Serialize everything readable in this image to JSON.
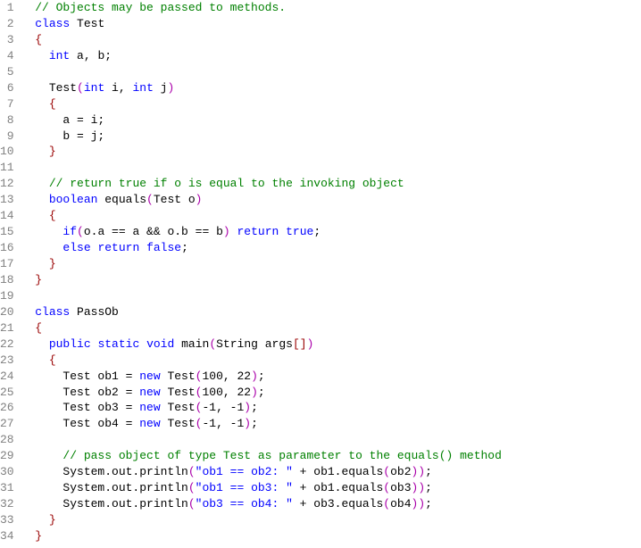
{
  "line_numbers": [
    "1",
    "2",
    "3",
    "4",
    "5",
    "6",
    "7",
    "8",
    "9",
    "10",
    "11",
    "12",
    "13",
    "14",
    "15",
    "16",
    "17",
    "18",
    "19",
    "20",
    "21",
    "22",
    "23",
    "24",
    "25",
    "26",
    "27",
    "28",
    "29",
    "30",
    "31",
    "32",
    "33",
    "34"
  ],
  "tokens": [
    [
      [
        "  ",
        "plain"
      ],
      [
        "// Objects may be passed to methods.",
        "comment"
      ]
    ],
    [
      [
        "  ",
        "plain"
      ],
      [
        "class",
        "keyword"
      ],
      [
        " Test",
        "plain"
      ]
    ],
    [
      [
        "  ",
        "plain"
      ],
      [
        "{",
        "brace"
      ]
    ],
    [
      [
        "    ",
        "plain"
      ],
      [
        "int",
        "keyword"
      ],
      [
        " a, b;",
        "plain"
      ]
    ],
    [
      [
        "",
        "plain"
      ]
    ],
    [
      [
        "    Test",
        "plain"
      ],
      [
        "(",
        "paren"
      ],
      [
        "int",
        "keyword"
      ],
      [
        " i, ",
        "plain"
      ],
      [
        "int",
        "keyword"
      ],
      [
        " j",
        "plain"
      ],
      [
        ")",
        "paren"
      ]
    ],
    [
      [
        "    ",
        "plain"
      ],
      [
        "{",
        "brace"
      ]
    ],
    [
      [
        "      a = i;",
        "plain"
      ]
    ],
    [
      [
        "      b = j;",
        "plain"
      ]
    ],
    [
      [
        "    ",
        "plain"
      ],
      [
        "}",
        "brace"
      ]
    ],
    [
      [
        "",
        "plain"
      ]
    ],
    [
      [
        "    ",
        "plain"
      ],
      [
        "// return true if o is equal to the invoking object",
        "comment"
      ]
    ],
    [
      [
        "    ",
        "plain"
      ],
      [
        "boolean",
        "keyword"
      ],
      [
        " equals",
        "plain"
      ],
      [
        "(",
        "paren"
      ],
      [
        "Test o",
        "plain"
      ],
      [
        ")",
        "paren"
      ]
    ],
    [
      [
        "    ",
        "plain"
      ],
      [
        "{",
        "brace"
      ]
    ],
    [
      [
        "      ",
        "plain"
      ],
      [
        "if",
        "keyword"
      ],
      [
        "(",
        "paren"
      ],
      [
        "o.a == a && o.b == b",
        "plain"
      ],
      [
        ")",
        "paren"
      ],
      [
        " ",
        "plain"
      ],
      [
        "return",
        "keyword"
      ],
      [
        " ",
        "plain"
      ],
      [
        "true",
        "keyword"
      ],
      [
        ";",
        "plain"
      ]
    ],
    [
      [
        "      ",
        "plain"
      ],
      [
        "else",
        "keyword"
      ],
      [
        " ",
        "plain"
      ],
      [
        "return",
        "keyword"
      ],
      [
        " ",
        "plain"
      ],
      [
        "false",
        "keyword"
      ],
      [
        ";",
        "plain"
      ]
    ],
    [
      [
        "    ",
        "plain"
      ],
      [
        "}",
        "brace"
      ]
    ],
    [
      [
        "  ",
        "plain"
      ],
      [
        "}",
        "brace"
      ]
    ],
    [
      [
        "",
        "plain"
      ]
    ],
    [
      [
        "  ",
        "plain"
      ],
      [
        "class",
        "keyword"
      ],
      [
        " PassOb",
        "plain"
      ]
    ],
    [
      [
        "  ",
        "plain"
      ],
      [
        "{",
        "brace"
      ]
    ],
    [
      [
        "    ",
        "plain"
      ],
      [
        "public",
        "keyword"
      ],
      [
        " ",
        "plain"
      ],
      [
        "static",
        "keyword"
      ],
      [
        " ",
        "plain"
      ],
      [
        "void",
        "keyword"
      ],
      [
        " main",
        "plain"
      ],
      [
        "(",
        "paren"
      ],
      [
        "String args",
        "plain"
      ],
      [
        "[]",
        "brace"
      ],
      [
        ")",
        "paren"
      ]
    ],
    [
      [
        "    ",
        "plain"
      ],
      [
        "{",
        "brace"
      ]
    ],
    [
      [
        "      Test ob1 = ",
        "plain"
      ],
      [
        "new",
        "keyword"
      ],
      [
        " Test",
        "plain"
      ],
      [
        "(",
        "paren"
      ],
      [
        "100, 22",
        "plain"
      ],
      [
        ")",
        "paren"
      ],
      [
        ";",
        "plain"
      ]
    ],
    [
      [
        "      Test ob2 = ",
        "plain"
      ],
      [
        "new",
        "keyword"
      ],
      [
        " Test",
        "plain"
      ],
      [
        "(",
        "paren"
      ],
      [
        "100, 22",
        "plain"
      ],
      [
        ")",
        "paren"
      ],
      [
        ";",
        "plain"
      ]
    ],
    [
      [
        "      Test ob3 = ",
        "plain"
      ],
      [
        "new",
        "keyword"
      ],
      [
        " Test",
        "plain"
      ],
      [
        "(",
        "paren"
      ],
      [
        "-1, -1",
        "plain"
      ],
      [
        ")",
        "paren"
      ],
      [
        ";",
        "plain"
      ]
    ],
    [
      [
        "      Test ob4 = ",
        "plain"
      ],
      [
        "new",
        "keyword"
      ],
      [
        " Test",
        "plain"
      ],
      [
        "(",
        "paren"
      ],
      [
        "-1, -1",
        "plain"
      ],
      [
        ")",
        "paren"
      ],
      [
        ";",
        "plain"
      ]
    ],
    [
      [
        "",
        "plain"
      ]
    ],
    [
      [
        "      ",
        "plain"
      ],
      [
        "// pass object of type Test as parameter to the equals() method",
        "comment"
      ]
    ],
    [
      [
        "      System.out.println",
        "plain"
      ],
      [
        "(",
        "paren"
      ],
      [
        "\"ob1 == ob2: \"",
        "string"
      ],
      [
        " + ob1.equals",
        "plain"
      ],
      [
        "(",
        "paren"
      ],
      [
        "ob2",
        "plain"
      ],
      [
        "))",
        "paren"
      ],
      [
        ";",
        "plain"
      ]
    ],
    [
      [
        "      System.out.println",
        "plain"
      ],
      [
        "(",
        "paren"
      ],
      [
        "\"ob1 == ob3: \"",
        "string"
      ],
      [
        " + ob1.equals",
        "plain"
      ],
      [
        "(",
        "paren"
      ],
      [
        "ob3",
        "plain"
      ],
      [
        "))",
        "paren"
      ],
      [
        ";",
        "plain"
      ]
    ],
    [
      [
        "      System.out.println",
        "plain"
      ],
      [
        "(",
        "paren"
      ],
      [
        "\"ob3 == ob4: \"",
        "string"
      ],
      [
        " + ob3.equals",
        "plain"
      ],
      [
        "(",
        "paren"
      ],
      [
        "ob4",
        "plain"
      ],
      [
        "))",
        "paren"
      ],
      [
        ";",
        "plain"
      ]
    ],
    [
      [
        "    ",
        "plain"
      ],
      [
        "}",
        "brace"
      ]
    ],
    [
      [
        "  ",
        "plain"
      ],
      [
        "}",
        "brace"
      ]
    ]
  ]
}
